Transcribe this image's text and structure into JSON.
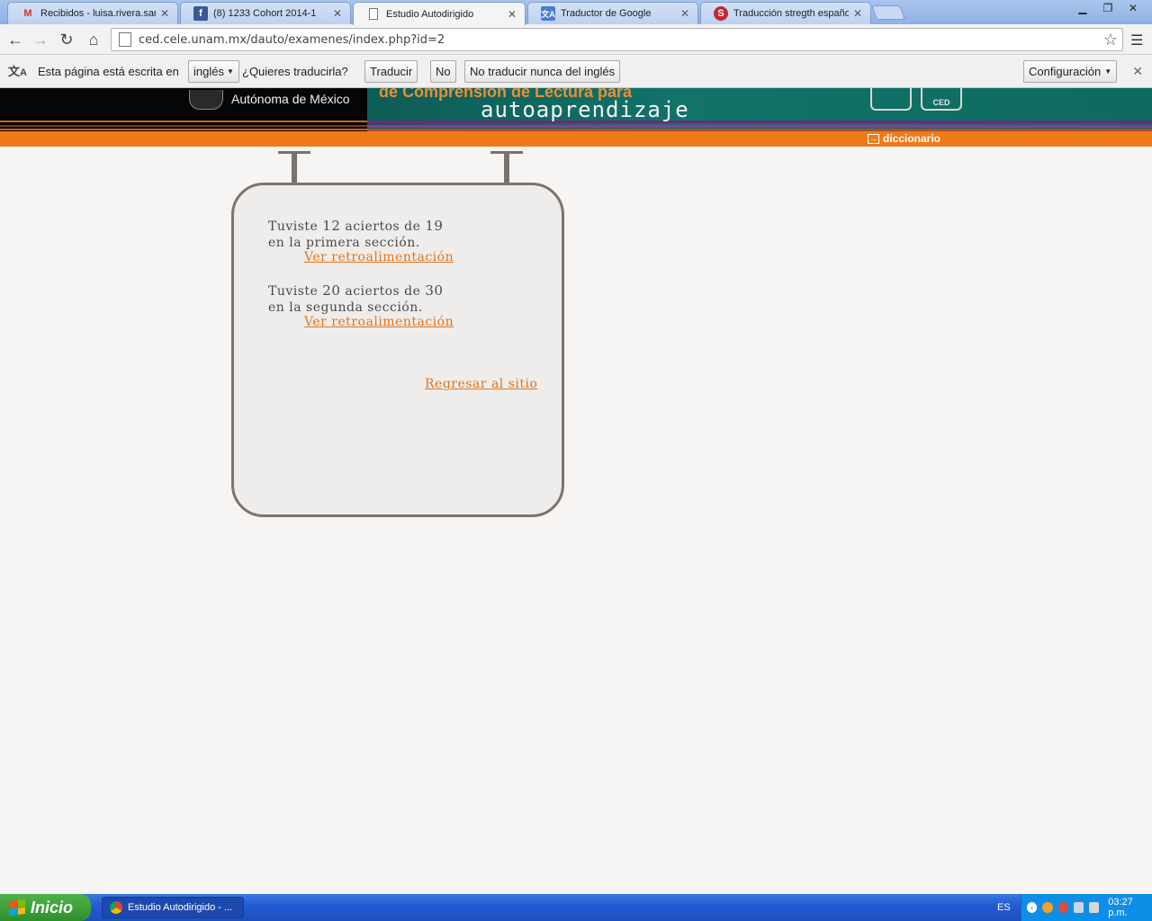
{
  "browser": {
    "tabs": [
      {
        "title": "Recibidos - luisa.rivera.sanch",
        "icon": "gmail-icon"
      },
      {
        "title": "(8) 1233 Cohort 2014-1",
        "icon": "facebook-icon"
      },
      {
        "title": "Estudio Autodirigido",
        "icon": "page-icon",
        "active": true
      },
      {
        "title": "Traductor de Google",
        "icon": "google-translate-icon"
      },
      {
        "title": "Traducción stregth español",
        "icon": "translate-site-icon"
      }
    ],
    "url": "ced.cele.unam.mx/dauto/examenes/index.php?id=2"
  },
  "translate_bar": {
    "lead": "Esta página está escrita en",
    "language": "inglés",
    "question": "¿Quieres traducirla?",
    "translate": "Traducir",
    "no": "No",
    "never": "No traducir nunca del inglés",
    "config": "Configuración"
  },
  "banner": {
    "university": "Autónoma de México",
    "line1": "de Comprensión de Lectura para",
    "line2": "autoaprendizaje",
    "logo2": "CED"
  },
  "orange_bar": {
    "diccionario": "diccionario"
  },
  "results": [
    {
      "prefix": "Tuviste",
      "score": "12",
      "middle": "aciertos de",
      "total": "19",
      "section": "en la primera sección.",
      "link": "Ver retroalimentación"
    },
    {
      "prefix": "Tuviste",
      "score": "20",
      "middle": "aciertos de",
      "total": "30",
      "section": "en la segunda sección.",
      "link": "Ver retroalimentación"
    }
  ],
  "back_link": "Regresar al sitio",
  "taskbar": {
    "start": "Inicio",
    "task": "Estudio Autodirigido - ...",
    "lang": "ES",
    "time": "03:27 p.m."
  },
  "colors": {
    "accent_orange": "#f07a1a",
    "link_orange": "#e2741e",
    "banner_teal": "#11736a",
    "sign_border": "#7c746e"
  }
}
